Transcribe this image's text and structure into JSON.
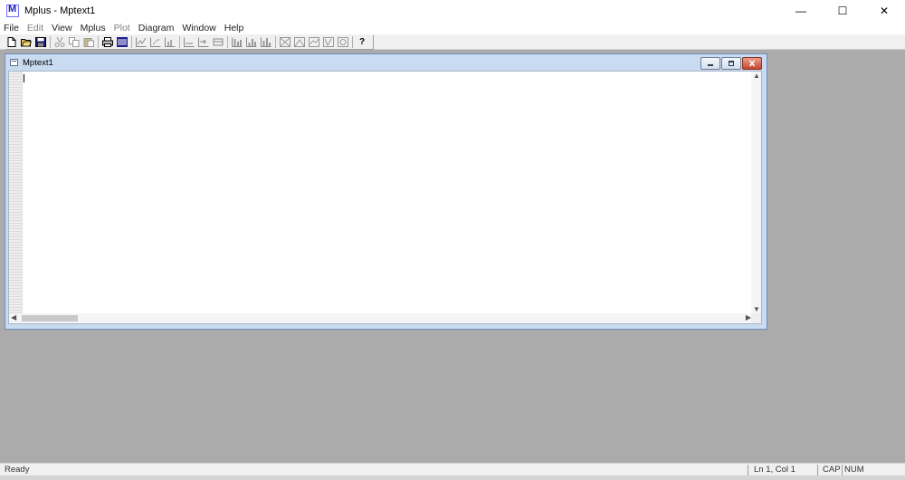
{
  "app": {
    "logo_letter": "M",
    "title": "Mplus - Mptext1",
    "controls": {
      "minimize": "—",
      "maximize": "☐",
      "close": "✕"
    }
  },
  "menu": [
    {
      "label": "File",
      "enabled": true
    },
    {
      "label": "Edit",
      "enabled": false
    },
    {
      "label": "View",
      "enabled": true
    },
    {
      "label": "Mplus",
      "enabled": true
    },
    {
      "label": "Plot",
      "enabled": false
    },
    {
      "label": "Diagram",
      "enabled": true
    },
    {
      "label": "Window",
      "enabled": true
    },
    {
      "label": "Help",
      "enabled": true
    }
  ],
  "toolbar": {
    "help_glyph": "?",
    "buttons": [
      "new-document-icon",
      "open-folder-icon",
      "save-icon",
      "cut-icon",
      "copy-icon",
      "paste-icon",
      "print-icon",
      "run-icon",
      "plot-line-icon",
      "plot-scatter-icon",
      "plot-histogram-icon",
      "plot-sample-icon",
      "plot-estimated-icon",
      "plot-observed-icon",
      "plot-bar-icon",
      "plot-bar-2-icon",
      "plot-bar-3-icon",
      "diagram-1-icon",
      "diagram-2-icon",
      "diagram-3-icon",
      "diagram-4-icon",
      "diagram-5-icon",
      "help-icon"
    ]
  },
  "document": {
    "title": "Mptext1",
    "content": ""
  },
  "status": {
    "message": "Ready",
    "position": "Ln 1, Col 1",
    "caps": "CAP",
    "num": "NUM"
  },
  "colors": {
    "desktop": "#ababab",
    "child_frame": "#c9dbf0",
    "close_button": "#c8452d"
  }
}
